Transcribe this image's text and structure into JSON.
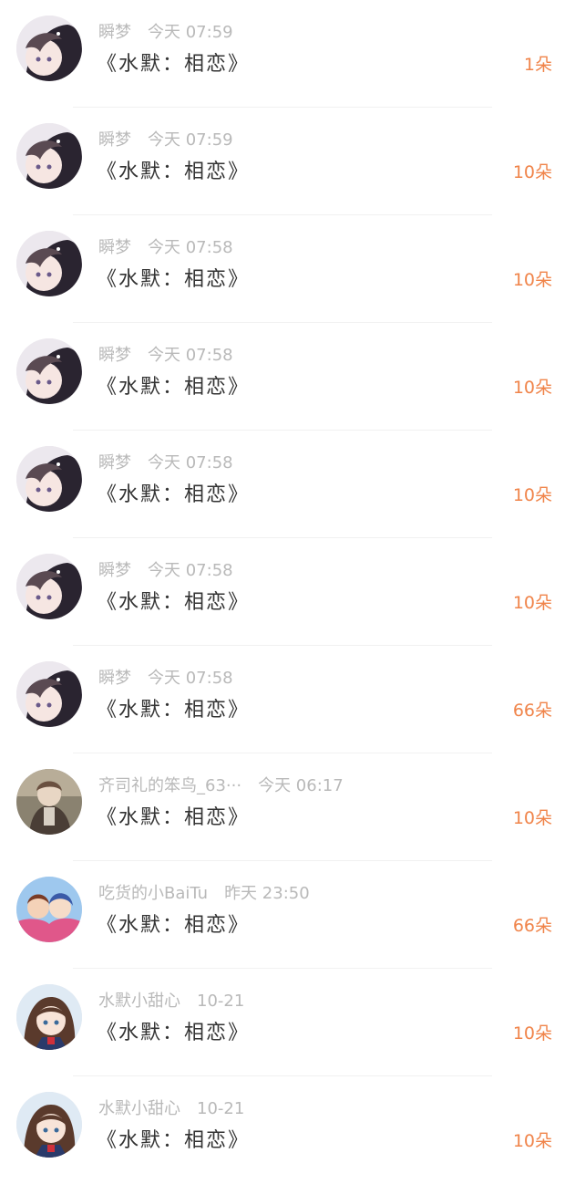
{
  "accent_color": "#f0844a",
  "items": [
    {
      "user": "瞬梦",
      "time": "今天 07:59",
      "title": "《水默：相恋》",
      "count": "1朵",
      "avatar": "anime-girl-dark-hair-icon"
    },
    {
      "user": "瞬梦",
      "time": "今天 07:59",
      "title": "《水默：相恋》",
      "count": "10朵",
      "avatar": "anime-girl-dark-hair-icon"
    },
    {
      "user": "瞬梦",
      "time": "今天 07:58",
      "title": "《水默：相恋》",
      "count": "10朵",
      "avatar": "anime-girl-dark-hair-icon"
    },
    {
      "user": "瞬梦",
      "time": "今天 07:58",
      "title": "《水默：相恋》",
      "count": "10朵",
      "avatar": "anime-girl-dark-hair-icon"
    },
    {
      "user": "瞬梦",
      "time": "今天 07:58",
      "title": "《水默：相恋》",
      "count": "10朵",
      "avatar": "anime-girl-dark-hair-icon"
    },
    {
      "user": "瞬梦",
      "time": "今天 07:58",
      "title": "《水默：相恋》",
      "count": "10朵",
      "avatar": "anime-girl-dark-hair-icon"
    },
    {
      "user": "瞬梦",
      "time": "今天 07:58",
      "title": "《水默：相恋》",
      "count": "66朵",
      "avatar": "anime-girl-dark-hair-icon"
    },
    {
      "user": "齐司礼的笨鸟_63···",
      "time": "今天 06:17",
      "title": "《水默：相恋》",
      "count": "10朵",
      "avatar": "anime-man-suit-icon"
    },
    {
      "user": "吃货的小BaiTu",
      "time": "昨天 23:50",
      "title": "《水默：相恋》",
      "count": "66朵",
      "avatar": "anime-couple-icon"
    },
    {
      "user": "水默小甜心",
      "time": "10-21",
      "title": "《水默：相恋》",
      "count": "10朵",
      "avatar": "anime-schoolgirl-icon"
    },
    {
      "user": "水默小甜心",
      "time": "10-21",
      "title": "《水默：相恋》",
      "count": "10朵",
      "avatar": "anime-schoolgirl-icon"
    }
  ]
}
